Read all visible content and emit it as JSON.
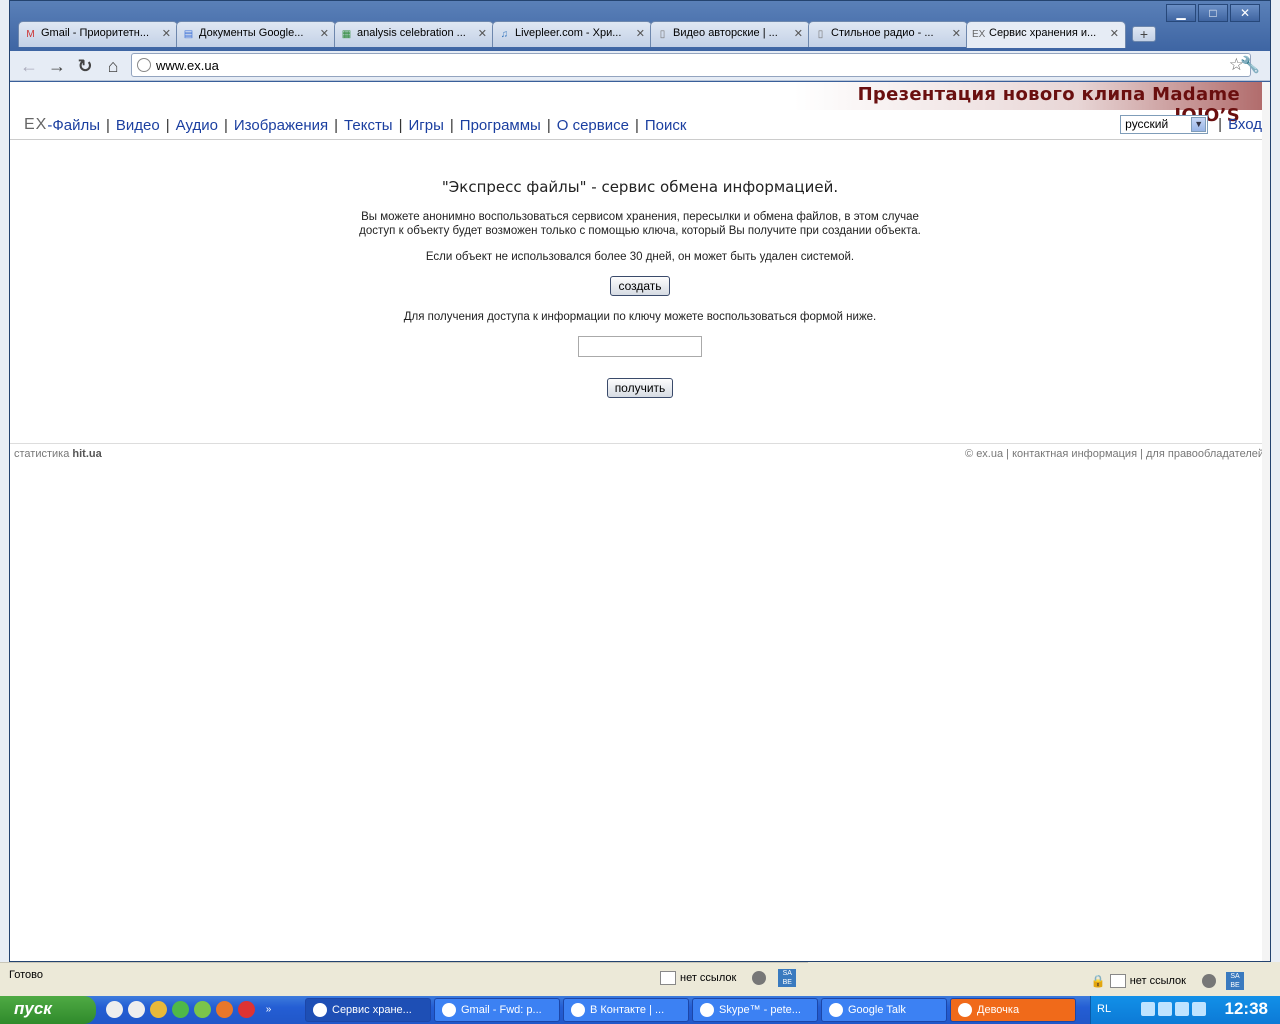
{
  "browser": {
    "tabs": [
      {
        "icon": "gmail-icon",
        "glyph": "M",
        "color": "#c33",
        "label": "Gmail - Приоритетн..."
      },
      {
        "icon": "google-docs-icon",
        "glyph": "▤",
        "color": "#3a6fd8",
        "label": "Документы Google..."
      },
      {
        "icon": "spreadsheet-icon",
        "glyph": "▦",
        "color": "#2e8b3a",
        "label": "analysis celebration ..."
      },
      {
        "icon": "music-note-icon",
        "glyph": "♫",
        "color": "#3a7abf",
        "label": "Livepleer.com - Хри..."
      },
      {
        "icon": "page-icon",
        "glyph": "▯",
        "color": "#777",
        "label": "Видео авторские | ..."
      },
      {
        "icon": "page-icon",
        "glyph": "▯",
        "color": "#777",
        "label": "Стильное радио - ..."
      },
      {
        "icon": "ex-logo-icon",
        "glyph": "EX",
        "color": "#666",
        "label": "Сервис хранения и...",
        "active": true
      }
    ],
    "new_tab": "+",
    "url": "www.ex.ua",
    "window_buttons": {
      "minimize": "▁",
      "maximize": "□",
      "close": "✕"
    }
  },
  "page": {
    "promo": "Презентация нового клипа Madame JOJO’S",
    "nav": {
      "logo": "EX",
      "items": [
        "-Файлы",
        "Видео",
        "Аудио",
        "Изображения",
        "Тексты",
        "Игры",
        "Программы",
        "О сервисе",
        "Поиск"
      ],
      "language": "русский",
      "login": "Вход"
    },
    "heading": "\"Экспресс файлы\" - сервис обмена информацией.",
    "intro_line1": "Вы можете анонимно воспользоваться сервисом хранения, пересылки и обмена файлов, в этом случае",
    "intro_line2": "доступ к объекту будет возможен только с помощью ключа, который Вы получите при создании объекта.",
    "retention": "Если объект не использовался более 30 дней, он может быть удален системой.",
    "create_button": "создать",
    "key_prompt": "Для получения доступа к информации по ключу можете воспользоваться формой ниже.",
    "key_value": "",
    "get_button": "получить",
    "footer": {
      "stats_prefix": "статистика",
      "stats_brand": "hit.ua",
      "copyright": "© ex.ua",
      "contacts": "контактная информация",
      "rightholders": "для правообладателей"
    }
  },
  "statusbar": {
    "ready": "Готово",
    "links": "нет ссылок",
    "links2": "нет ссылок",
    "sa": "SA\nBE",
    "sa2": "SA\nBE"
  },
  "taskbar": {
    "start": "пуск",
    "quick_more": "»",
    "tasks": [
      {
        "label": "Сервис хране...",
        "icon": "chrome-icon",
        "active": true
      },
      {
        "label": "Gmail - Fwd: p...",
        "icon": "firefox-icon"
      },
      {
        "label": "В Контакте | ...",
        "icon": "firefox-icon"
      },
      {
        "label": "Skype™ - pete...",
        "icon": "skype-icon"
      },
      {
        "label": "Google Talk",
        "icon": "chat-bubble-icon"
      },
      {
        "label": "Девочка",
        "icon": "chat-bubble-icon",
        "orange": true
      }
    ],
    "tray_lang": "RL",
    "clock": "12:38"
  }
}
